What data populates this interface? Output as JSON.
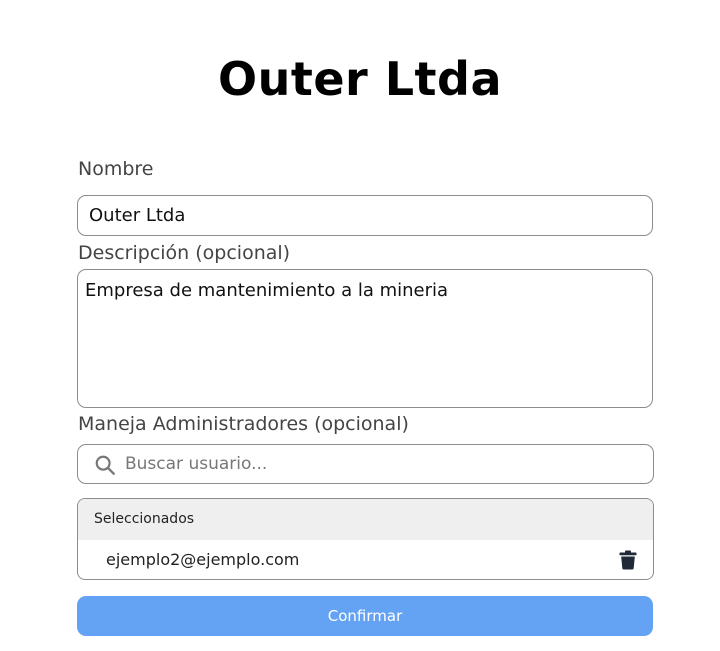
{
  "page": {
    "title": "Outer Ltda"
  },
  "form": {
    "name": {
      "label": "Nombre",
      "value": "Outer Ltda"
    },
    "description": {
      "label": "Descripción (opcional)",
      "value": "Empresa de mantenimiento a la mineria"
    },
    "admins": {
      "label": "Maneja Administradores (opcional)",
      "search_placeholder": "Buscar usuario...",
      "search_icon": "search-icon",
      "selected_header": "Seleccionados",
      "selected": [
        {
          "email": "ejemplo2@ejemplo.com",
          "remove_icon": "trash-icon"
        }
      ]
    },
    "confirm_label": "Confirmar"
  },
  "colors": {
    "primary_button": "#64a3f3",
    "border": "#8c8c8c",
    "selected_header_bg": "#efefef",
    "icon": "#1f2937"
  }
}
